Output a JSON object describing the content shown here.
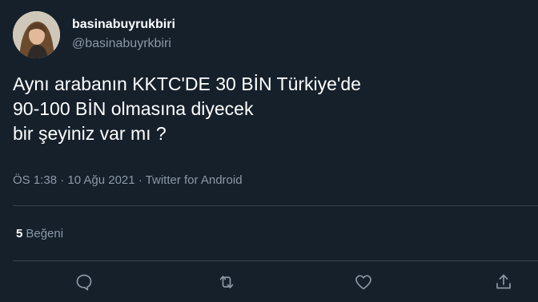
{
  "author": {
    "display_name": "basinabuyrukbiri",
    "handle": "@basinabuyrkbiri"
  },
  "tweet": {
    "lines": [
      "Aynı arabanın KKTC'DE 30 BİN Türkiye'de",
      "90-100 BİN olmasına diyecek",
      "bir şeyiniz var mı ?"
    ],
    "meta": "ÖS 1:38 · 10 Ağu 2021 · Twitter for Android"
  },
  "stats": {
    "likes_count": "5",
    "likes_label": "Beğeni"
  },
  "actions": {
    "reply_icon": "reply-icon",
    "retweet_icon": "retweet-icon",
    "like_icon": "heart-icon",
    "share_icon": "share-icon"
  },
  "colors": {
    "background": "#15202b",
    "secondary_text": "#8b98a5",
    "divider": "#38444d"
  }
}
